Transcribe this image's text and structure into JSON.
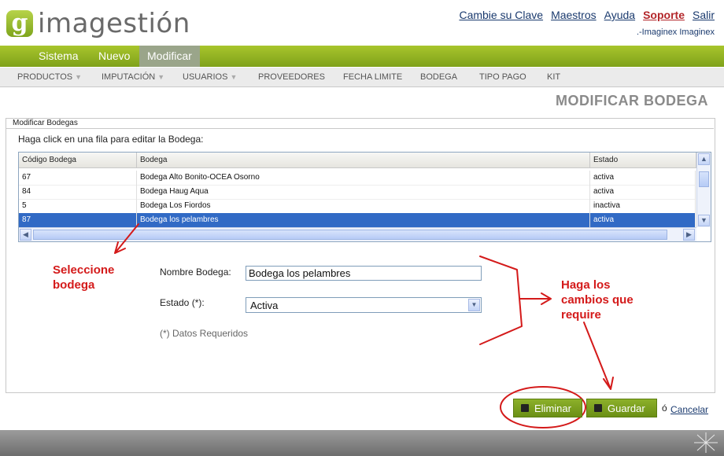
{
  "logo": {
    "mark": "g",
    "text": "imagestión"
  },
  "top_links": {
    "change_password": "Cambie su Clave",
    "masters": "Maestros",
    "help": "Ayuda",
    "support": "Soporte",
    "logout": "Salir"
  },
  "user_line": ".-Imaginex Imaginex",
  "main_menu": [
    "Sistema",
    "Nuevo",
    "Modificar"
  ],
  "sub_menu": [
    "PRODUCTOS",
    "IMPUTACIÓN",
    "USUARIOS",
    "PROVEEDORES",
    "FECHA LIMITE",
    "BODEGA",
    "TIPO PAGO",
    "KIT"
  ],
  "page_title": "MODIFICAR BODEGA",
  "panel": {
    "legend": "Modificar Bodegas",
    "instructions": "Haga click en una fila para editar la Bodega:"
  },
  "grid": {
    "headers": [
      "Código Bodega",
      "Bodega",
      "Estado"
    ],
    "rows": [
      {
        "code": "67",
        "name": "Bodega Alto Bonito-OCEA Osorno",
        "status": "activa"
      },
      {
        "code": "84",
        "name": "Bodega Haug Aqua",
        "status": "activa"
      },
      {
        "code": "5",
        "name": "Bodega Los Fiordos",
        "status": "inactiva"
      },
      {
        "code": "87",
        "name": "Bodega los pelambres",
        "status": "activa"
      }
    ],
    "selected_row": 3
  },
  "form": {
    "name_label": "Nombre Bodega:",
    "name_value": "Bodega los pelambres",
    "status_label": "Estado (*):",
    "status_value": "Activa",
    "required_note": "(*) Datos Requeridos"
  },
  "annotations": {
    "select": [
      "Seleccione",
      "bodega"
    ],
    "changes": [
      "Haga los",
      "cambios que",
      "require"
    ],
    "annotation_color": "#d41a1a"
  },
  "buttons": {
    "delete": "Eliminar",
    "save": "Guardar",
    "or": "ó",
    "cancel": "Cancelar"
  },
  "colors": {
    "brand_green": "#8cb02a",
    "selection_blue": "#316ac5",
    "link_blue": "#1a3a6e",
    "support_red": "#b3262a"
  }
}
